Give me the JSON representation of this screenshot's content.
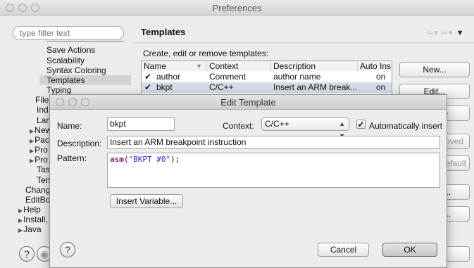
{
  "preferences": {
    "title": "Preferences",
    "filter_placeholder": "type filter text",
    "tree": {
      "items": [
        {
          "label": "Save Actions"
        },
        {
          "label": "Scalability"
        },
        {
          "label": "Syntax Coloring"
        },
        {
          "label": "Templates",
          "selected": true
        },
        {
          "label": "Typing"
        }
      ],
      "partial": [
        "File",
        "Ind",
        "Lan",
        "New",
        "Pac",
        "Pro",
        "Pro",
        "Tas",
        "Ten",
        "Chang",
        "EditBo:",
        "Help",
        "Install,",
        "Java"
      ]
    },
    "page_title": "Templates",
    "description": "Create, edit or remove templates:",
    "table": {
      "columns": [
        "Name",
        "Context",
        "Description",
        "Auto Ins"
      ],
      "rows": [
        {
          "checked": true,
          "name": "author",
          "context": "Comment",
          "description": "author name",
          "auto": "on"
        },
        {
          "checked": true,
          "name": "bkpt",
          "context": "C/C++",
          "description": "Insert an ARM break...",
          "auto": "on"
        }
      ]
    },
    "buttons": {
      "new": "New...",
      "edit": "Edit...",
      "partial": [
        "e",
        "noved",
        "efault",
        "..",
        ".."
      ]
    },
    "help": "?"
  },
  "dialog": {
    "title": "Edit Template",
    "name_label": "Name:",
    "name_value": "bkpt",
    "context_label": "Context:",
    "context_value": "C/C++",
    "auto_insert_label": "Automatically insert",
    "auto_insert_checked": true,
    "description_label": "Description:",
    "description_value": "Insert an ARM breakpoint instruction",
    "pattern_label": "Pattern:",
    "pattern_keyword": "asm",
    "pattern_open": "(",
    "pattern_string": "\"BKPT #0\"",
    "pattern_close": ");",
    "insert_variable": "Insert Variable...",
    "cancel": "Cancel",
    "ok": "OK",
    "help": "?"
  }
}
